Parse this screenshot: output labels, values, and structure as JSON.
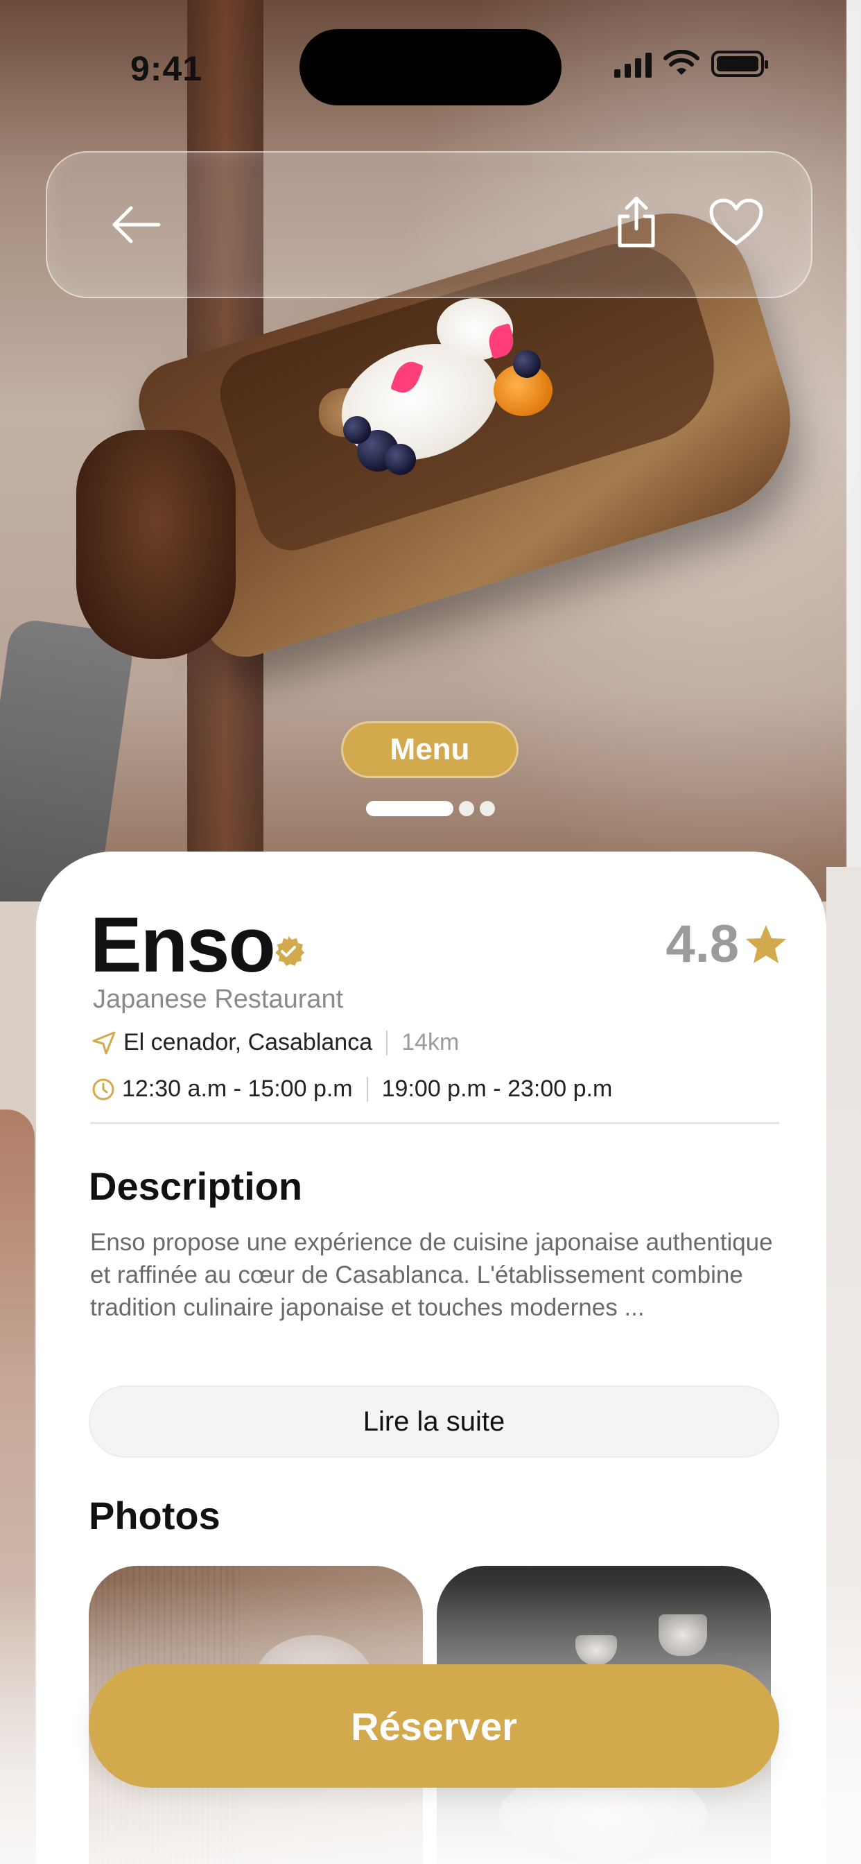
{
  "status_bar": {
    "time": "9:41"
  },
  "nav": {
    "back_icon": "arrow-left-icon",
    "share_icon": "share-icon",
    "favorite_icon": "heart-icon"
  },
  "hero": {
    "badge_label": "Menu",
    "carousel": {
      "total": 3,
      "active": 1
    }
  },
  "restaurant": {
    "name": "Enso",
    "rating": "4.8",
    "type": "Japanese Restaurant",
    "location": "El cenador, Casablanca",
    "distance": "14km",
    "hours": [
      "12:30 a.m - 15:00 p.m",
      "19:00 p.m - 23:00 p.m"
    ]
  },
  "description": {
    "heading": "Description",
    "text": "Enso propose une expérience de cuisine japonaise authentique et raffinée au cœur de Casablanca. L'établissement combine tradition culinaire japonaise et touches modernes ...",
    "read_more_label": "Lire la suite"
  },
  "photos": {
    "heading": "Photos"
  },
  "cta": {
    "reserve_label": "Réserver"
  },
  "colors": {
    "accent": "#D3A94D",
    "text_primary": "#111111",
    "text_muted": "#8A8A8A"
  }
}
